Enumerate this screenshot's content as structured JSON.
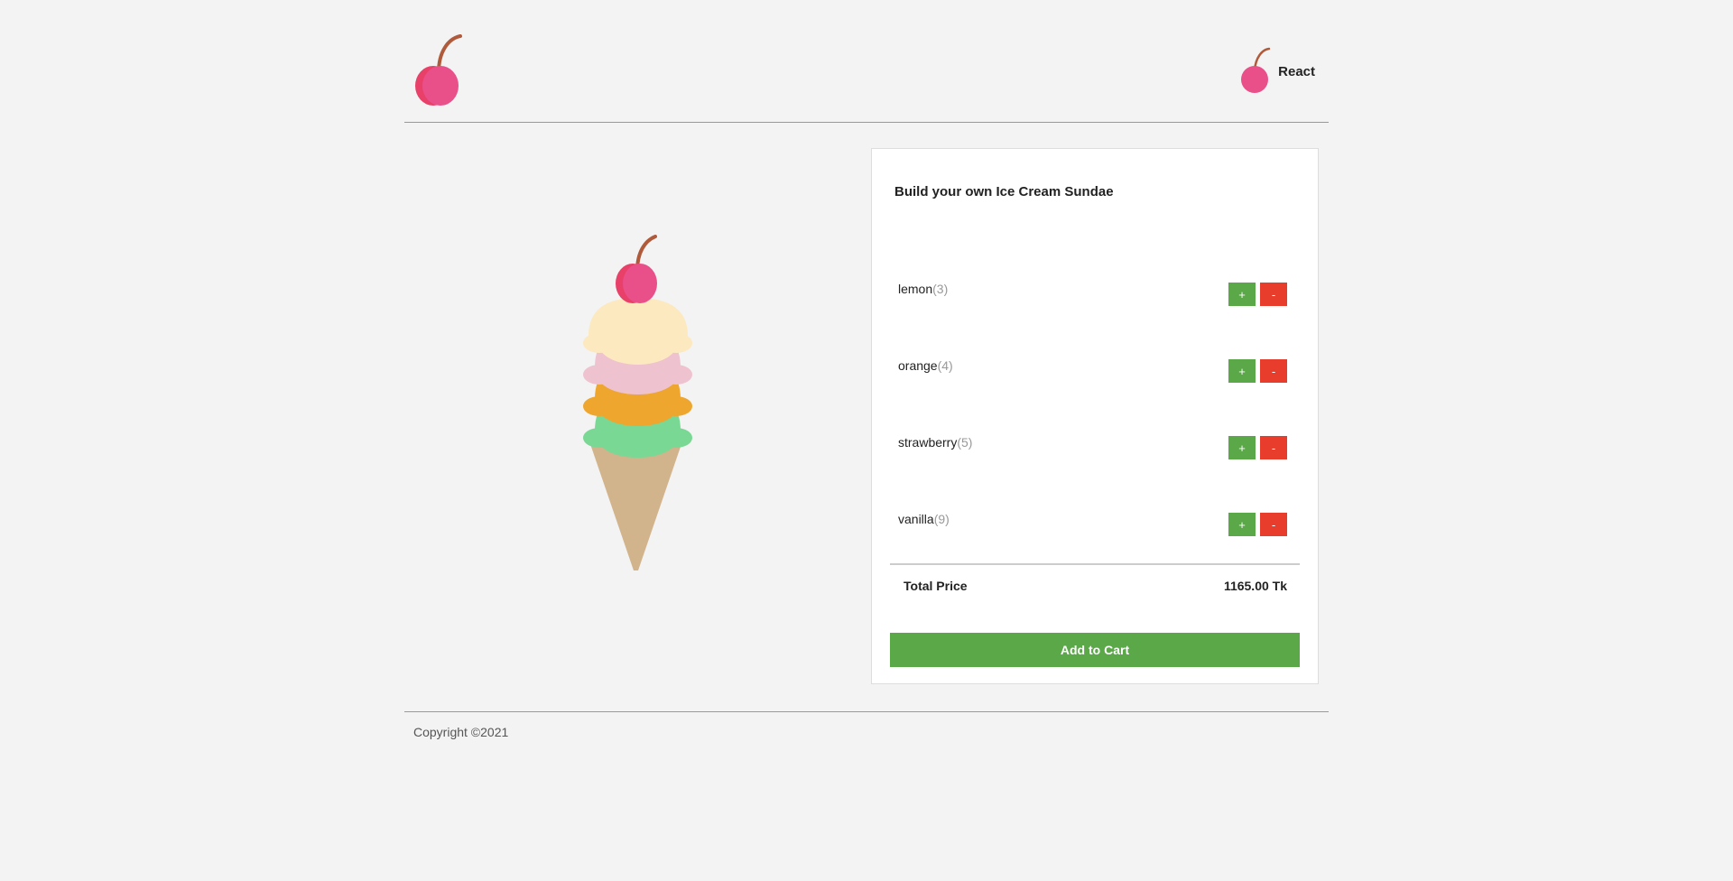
{
  "header": {
    "logo_icon": "cherry-icon",
    "nav_label": "React",
    "nav_icon": "cherry-icon"
  },
  "builder": {
    "title": "Build your own Ice Cream Sundae",
    "flavors": [
      {
        "name": "lemon",
        "count": "(3)",
        "color": "#fce9c0"
      },
      {
        "name": "orange",
        "count": "(4)",
        "color": "#eec2ce"
      },
      {
        "name": "strawberry",
        "count": "(5)",
        "color": "#eea62f"
      },
      {
        "name": "vanilla",
        "count": "(9)",
        "color": "#79d893"
      }
    ],
    "plus_label": "+",
    "minus_label": "-",
    "total_label": "Total Price",
    "total_value": "1165.00 Tk",
    "add_to_cart_label": "Add to Cart"
  },
  "colors": {
    "background": "#f3f3f3",
    "green": "#5aa847",
    "red": "#e83d2c",
    "cherry": "#e94f89",
    "cone": "#d2b48c"
  },
  "footer": {
    "copyright": "Copyright ©2021"
  }
}
